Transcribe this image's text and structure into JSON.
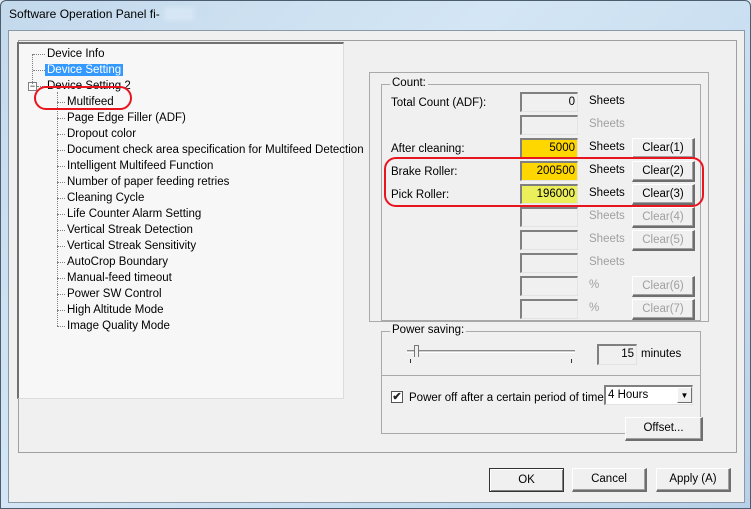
{
  "window": {
    "title": "Software Operation Panel fi-"
  },
  "tree": {
    "items": [
      {
        "label": "Device Info",
        "level": 0
      },
      {
        "label": "Device Setting",
        "level": 0,
        "selected": true
      },
      {
        "label": "Device Setting 2",
        "level": 0,
        "expanded": true,
        "expander": "−"
      },
      {
        "label": "Multifeed",
        "level": 1
      },
      {
        "label": "Page Edge Filler (ADF)",
        "level": 1
      },
      {
        "label": "Dropout color",
        "level": 1
      },
      {
        "label": "Document check area specification for Multifeed Detection",
        "level": 1
      },
      {
        "label": "Intelligent Multifeed Function",
        "level": 1
      },
      {
        "label": "Number of paper feeding retries",
        "level": 1
      },
      {
        "label": "Cleaning Cycle",
        "level": 1
      },
      {
        "label": "Life Counter Alarm Setting",
        "level": 1
      },
      {
        "label": "Vertical Streak Detection",
        "level": 1
      },
      {
        "label": "Vertical Streak Sensitivity",
        "level": 1
      },
      {
        "label": "AutoCrop Boundary",
        "level": 1
      },
      {
        "label": "Manual-feed timeout",
        "level": 1
      },
      {
        "label": "Power SW Control",
        "level": 1
      },
      {
        "label": "High Altitude Mode",
        "level": 1
      },
      {
        "label": "Image Quality Mode",
        "level": 1
      }
    ]
  },
  "count": {
    "legend": "Count:",
    "rows": [
      {
        "label": "Total Count (ADF):",
        "value": "0",
        "unit": "Sheets",
        "unit_disabled": false,
        "button": null,
        "bg": "#f0f0f0"
      },
      {
        "label": "",
        "value": "",
        "unit": "Sheets",
        "unit_disabled": true,
        "button": null,
        "bg": "#f0f0f0"
      },
      {
        "label": "After cleaning:",
        "value": "5000",
        "unit": "Sheets",
        "unit_disabled": false,
        "button": "Clear(1)",
        "button_disabled": false,
        "bg": "#ffd700"
      },
      {
        "label": "Brake Roller:",
        "value": "200500",
        "unit": "Sheets",
        "unit_disabled": false,
        "button": "Clear(2)",
        "button_disabled": false,
        "bg": "#ffd700"
      },
      {
        "label": "Pick Roller:",
        "value": "196000",
        "unit": "Sheets",
        "unit_disabled": false,
        "button": "Clear(3)",
        "button_disabled": false,
        "bg": "#ebf05a"
      },
      {
        "label": "",
        "value": "",
        "unit": "Sheets",
        "unit_disabled": true,
        "button": "Clear(4)",
        "button_disabled": true,
        "bg": "#f0f0f0"
      },
      {
        "label": "",
        "value": "",
        "unit": "Sheets",
        "unit_disabled": true,
        "button": "Clear(5)",
        "button_disabled": true,
        "bg": "#f0f0f0"
      },
      {
        "label": "",
        "value": "",
        "unit": "Sheets",
        "unit_disabled": true,
        "button": null,
        "bg": "#f0f0f0"
      },
      {
        "label": "",
        "value": "",
        "unit": "%",
        "unit_disabled": true,
        "button": "Clear(6)",
        "button_disabled": true,
        "bg": "#f0f0f0"
      },
      {
        "label": "",
        "value": "",
        "unit": "%",
        "unit_disabled": true,
        "button": "Clear(7)",
        "button_disabled": true,
        "bg": "#f0f0f0"
      }
    ]
  },
  "power_saving": {
    "legend": "Power saving:",
    "slider_fraction": 0.04,
    "minutes_value": "15",
    "minutes_unit": "minutes",
    "power_off_checked": true,
    "power_off_label": "Power off after a certain period of time",
    "power_off_period": "4 Hours"
  },
  "buttons": {
    "offset": "Offset...",
    "ok": "OK",
    "cancel": "Cancel",
    "apply": "Apply (A)"
  },
  "colors": {
    "selection": "#3399ff",
    "annotation_red": "#e8141e"
  }
}
